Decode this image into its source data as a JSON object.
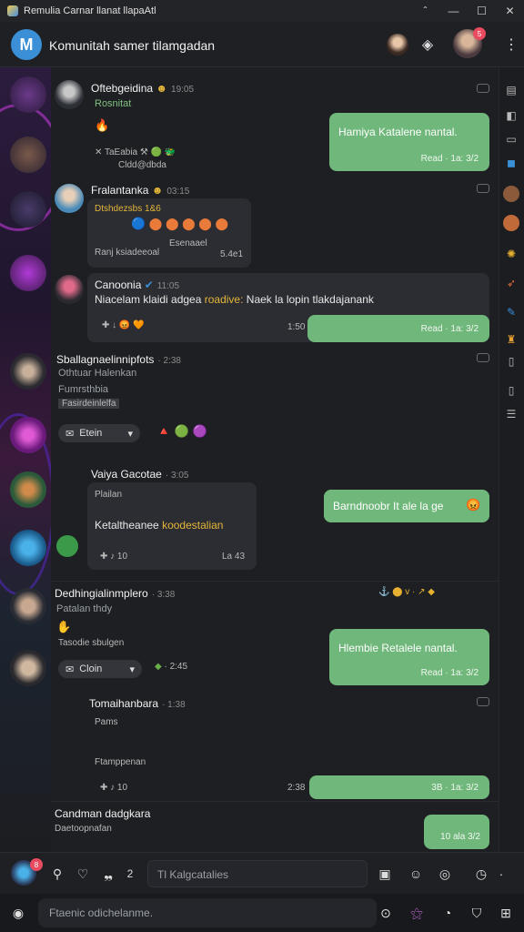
{
  "window": {
    "title": "Remulia Carnar llanat llapaAtl",
    "controls": [
      "ˆ",
      "—",
      "☐",
      "✕"
    ]
  },
  "header": {
    "server_initial": "M",
    "server_name": "Komunitah samer tilamgadan",
    "badge": "5"
  },
  "messages": {
    "m1": {
      "name": "Oftebgeidina",
      "time": "19:05",
      "role": "Rosnitat",
      "line1": "🔥",
      "reactions": "✕  TaEabia  ⚒ 🟢 🐲",
      "reactions_sub": "Cldd@dbda",
      "mine_text": "Hamiya Katalene nantal.",
      "mine_meta": "Read · 1a: 3/2"
    },
    "m2": {
      "name": "Fralantanka",
      "time": "03:15",
      "line1": "Dtshdezsbs 1&6",
      "line2": "🔵  ⬤ ⬤ ⬤ ⬤ ⬤",
      "line3_left": "Ranj ksiadeeoal",
      "line3_top": "Esenaael",
      "line3_right": "5.4e1"
    },
    "m3": {
      "name": "Canoonia",
      "time": "11:05",
      "text_a": "Niacelam klaidi adgea",
      "text_highlight": "roadive:",
      "text_b": "Naek la lopin tlakdajanank",
      "reactions": "✚ ↓  😡  🧡",
      "time_right": "1:50",
      "mine_meta": "Read · 1a: 3/2"
    },
    "m4": {
      "name": "Sballagnaelinnipfots",
      "time": "2:38",
      "line1": "Othtuar Halenkan",
      "line2": "Fumrsthbia",
      "line3": "Fasirdeinlelfa",
      "chip": "Etein",
      "reactions": "🔺 🟢 🟣",
      "mine_text": "Barndnoobr It ale la ge",
      "mine_emoji": "😡"
    },
    "m5": {
      "name": "Vaiya Gacotae",
      "time": "3:05",
      "line1": "Plailan",
      "line2_a": "Ketaltheanee",
      "line2_b": "koodestalian",
      "footer_a": "✚ ♪ 10",
      "footer_b": "La 43"
    },
    "m6": {
      "name": "Dedhingialinmplero",
      "time": "3:38",
      "line1": "Patalan thdy",
      "line2": "Tasodie sbulgen",
      "chip": "Cloin",
      "time2": "2:45",
      "icons_right": "⚓ ⬤ v · ↗ ◆",
      "mine_text": "Hlembie Retalele nantal.",
      "mine_meta": "Read · 1a: 3/2"
    },
    "m7": {
      "name": "Tomaihanbara",
      "time": "1:38",
      "line1": "Pams",
      "line2": "Ftamppenan",
      "footer": "✚ ♪ 10",
      "time_right": "2:38",
      "mine_meta": "3B · 1a: 3/2"
    },
    "m8": {
      "name": "Candman dadgkara",
      "line1": "Daetoopnafan",
      "mine_meta": "10 ala 3/2"
    }
  },
  "composer": {
    "icons": [
      "user-icon",
      "heart-icon",
      "quote-icon"
    ],
    "count": "2",
    "placeholder": "Tl Kalgcatalies",
    "badge": "8"
  },
  "bottombar": {
    "search_placeholder": "Ftaenic odichelanme."
  }
}
